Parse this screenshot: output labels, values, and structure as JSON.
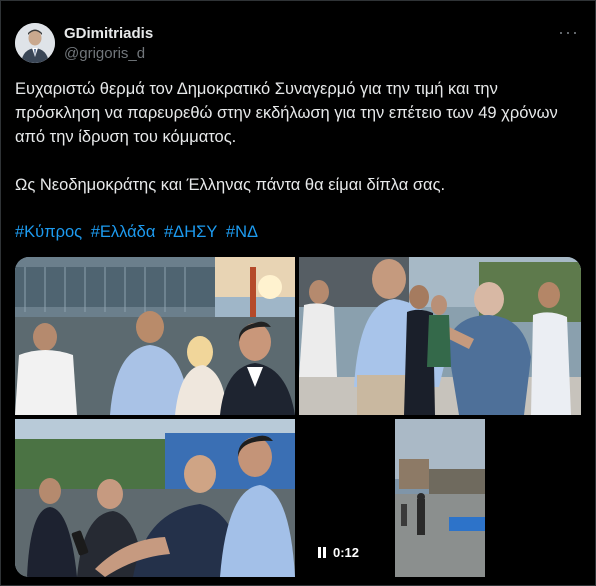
{
  "tweet": {
    "display_name": "GDimitriadis",
    "handle": "@grigoris_d",
    "more_label": "···",
    "text": "Ευχαριστώ θερμά τον Δημοκρατικό Συναγερμό για την τιμή και την πρόσκληση να παρευρεθώ στην εκδήλωση για την επέτειο των 49 χρόνων από την ίδρυση του κόμματος.\n\nΩς Νεοδημοκράτης και Έλληνας πάντα θα είμαι δίπλα σας.",
    "hashtags": [
      "#Κύπρος",
      "#Ελλάδα",
      "#ΔΗΣΥ",
      "#ΝΔ"
    ]
  },
  "media": {
    "video_duration": "0:12",
    "play_state_icon": "pause-icon"
  },
  "colors": {
    "background": "#000000",
    "text": "#e7e9ea",
    "secondary": "#71767b",
    "link": "#1d9bf0",
    "border": "#2f3336"
  }
}
